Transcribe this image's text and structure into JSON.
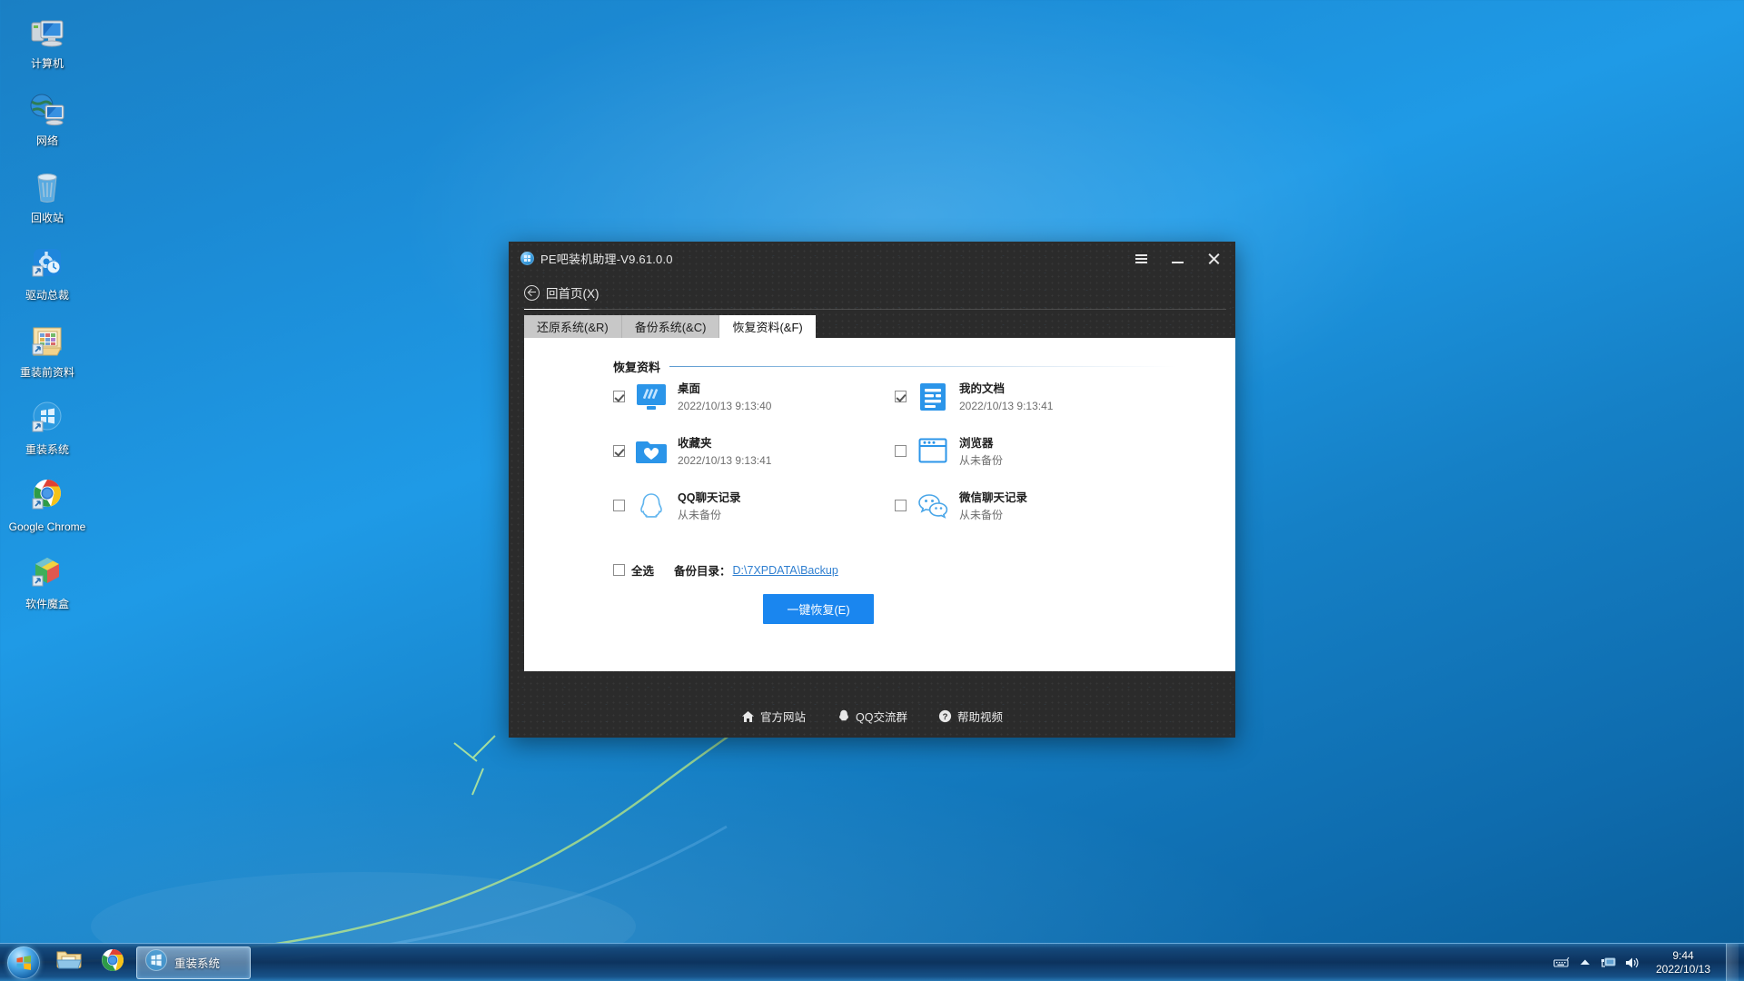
{
  "desktop": {
    "icons": [
      {
        "label": "计算机",
        "icon": "computer-icon"
      },
      {
        "label": "网络",
        "icon": "network-icon"
      },
      {
        "label": "回收站",
        "icon": "recycle-bin-icon"
      },
      {
        "label": "驱动总裁",
        "icon": "driver-tool-icon"
      },
      {
        "label": "重装前资料",
        "icon": "folder-backup-icon"
      },
      {
        "label": "重装系统",
        "icon": "reinstall-system-icon"
      },
      {
        "label": "Google Chrome",
        "icon": "chrome-icon"
      },
      {
        "label": "软件魔盒",
        "icon": "software-box-icon"
      }
    ]
  },
  "window": {
    "title": "PE吧装机助理-V9.61.0.0",
    "title_icon": "app-logo-icon",
    "controls": {
      "menu": "menu-icon",
      "minimize": "minimize-icon",
      "close": "close-icon"
    },
    "nav": {
      "back_label": "回首页(X)",
      "back_icon": "arrow-left-circle-icon"
    },
    "tabs": [
      {
        "label": "还原系统(&R)",
        "active": false
      },
      {
        "label": "备份系统(&C)",
        "active": false
      },
      {
        "label": "恢复资料(&F)",
        "active": true
      }
    ],
    "group_title": "恢复资料",
    "items": [
      {
        "name": "桌面",
        "sub": "2022/10/13 9:13:40",
        "checked": true,
        "icon": "monitor-icon"
      },
      {
        "name": "我的文档",
        "sub": "2022/10/13 9:13:41",
        "checked": true,
        "icon": "documents-icon"
      },
      {
        "name": "收藏夹",
        "sub": "2022/10/13 9:13:41",
        "checked": true,
        "icon": "favorites-folder-icon"
      },
      {
        "name": "浏览器",
        "sub": "从未备份",
        "checked": false,
        "icon": "browser-window-icon"
      },
      {
        "name": "QQ聊天记录",
        "sub": "从未备份",
        "checked": false,
        "icon": "qq-penguin-icon"
      },
      {
        "name": "微信聊天记录",
        "sub": "从未备份",
        "checked": false,
        "icon": "wechat-icon"
      }
    ],
    "select_all": {
      "label": "全选",
      "checked": false
    },
    "backup_dir": {
      "label": "备份目录：",
      "path": "D:\\7XPDATA\\Backup"
    },
    "primary_button": "一键恢复(E)",
    "footer_links": [
      {
        "label": "官方网站",
        "icon": "home-icon"
      },
      {
        "label": "QQ交流群",
        "icon": "qq-penguin-icon"
      },
      {
        "label": "帮助视频",
        "icon": "question-circle-icon"
      }
    ],
    "accent_color": "#1a86ef"
  },
  "taskbar": {
    "start_icon": "windows-start-icon",
    "pinned": [
      {
        "icon": "file-explorer-icon"
      },
      {
        "icon": "chrome-icon"
      }
    ],
    "active_task": {
      "label": "重装系统",
      "icon": "reinstall-system-icon"
    },
    "tray": [
      {
        "icon": "keyboard-icon"
      },
      {
        "icon": "show-hidden-icons-arrow"
      },
      {
        "icon": "network-icon"
      },
      {
        "icon": "volume-icon"
      }
    ],
    "clock": {
      "time": "9:44",
      "date": "2022/10/13"
    }
  }
}
